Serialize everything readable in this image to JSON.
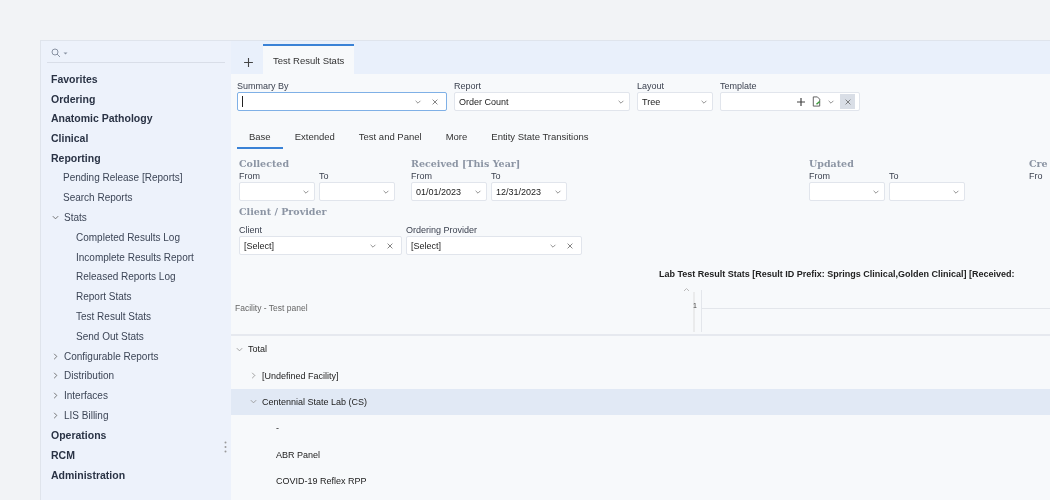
{
  "sidebar": {
    "items": [
      {
        "label": "Favorites"
      },
      {
        "label": "Ordering"
      },
      {
        "label": "Anatomic Pathology"
      },
      {
        "label": "Clinical"
      },
      {
        "label": "Reporting",
        "children": [
          {
            "label": "Pending Release [Reports]"
          },
          {
            "label": "Search Reports"
          },
          {
            "label": "Stats",
            "expanded": true,
            "children": [
              {
                "label": "Completed Results Log"
              },
              {
                "label": "Incomplete Results Report"
              },
              {
                "label": "Released Reports Log"
              },
              {
                "label": "Report Stats"
              },
              {
                "label": "Test Result Stats"
              },
              {
                "label": "Send Out Stats"
              }
            ]
          },
          {
            "label": "Configurable Reports",
            "expanded": false
          },
          {
            "label": "Distribution",
            "expanded": false
          },
          {
            "label": "Interfaces",
            "expanded": false
          },
          {
            "label": "LIS Billing",
            "expanded": false
          }
        ]
      },
      {
        "label": "Operations"
      },
      {
        "label": "RCM"
      },
      {
        "label": "Administration"
      }
    ]
  },
  "doc_tabs": [
    {
      "label": "Test Result Stats",
      "selected": true
    }
  ],
  "top_fields": [
    {
      "label": "Summary By",
      "kind": "combo",
      "focused": true
    },
    {
      "label": "Report",
      "value": "Order Count",
      "kind": "select"
    },
    {
      "label": "Layout",
      "value": "Tree",
      "kind": "select"
    },
    {
      "label": "Template",
      "kind": "template"
    }
  ],
  "sub_tabs": [
    {
      "label": "Base",
      "selected": true
    },
    {
      "label": "Extended",
      "selected": false
    },
    {
      "label": "Test and Panel",
      "selected": false
    },
    {
      "label": "More",
      "selected": false
    },
    {
      "label": "Entity State Transitions",
      "selected": false
    }
  ],
  "date_groups": [
    {
      "title": "Collected",
      "from_label": "From",
      "to_label": "To"
    },
    {
      "title": "Received [This Year]",
      "from_label": "From",
      "to_label": "To",
      "from": "01/01/2023",
      "to": "12/31/2023"
    },
    {
      "title": "Updated",
      "from_label": "From",
      "to_label": "To"
    },
    {
      "title": "Cre",
      "from_label": "Fro"
    }
  ],
  "client_provider": {
    "title": "Client / Provider",
    "fields": [
      {
        "label": "Client",
        "value": "[Select]"
      },
      {
        "label": "Ordering Provider",
        "value": "[Select]"
      }
    ]
  },
  "report": {
    "title": "Lab Test Result Stats [Result ID Prefix: Springs Clinical,Golden Clinical] [Received:",
    "row_header": "Facility - Test panel",
    "axis_tick": "1",
    "rows": [
      {
        "label": "Total",
        "expanded": true,
        "selected": false,
        "children": [
          {
            "label": "[Undefined Facility]",
            "expanded": false,
            "selected": false
          },
          {
            "label": "Centennial State Lab (CS)",
            "expanded": true,
            "selected": true,
            "children": [
              {
                "label": "-",
                "selected": false
              },
              {
                "label": "ABR Panel",
                "selected": false
              },
              {
                "label": "COVID-19 Reflex RPP",
                "selected": false
              }
            ]
          }
        ]
      }
    ]
  }
}
